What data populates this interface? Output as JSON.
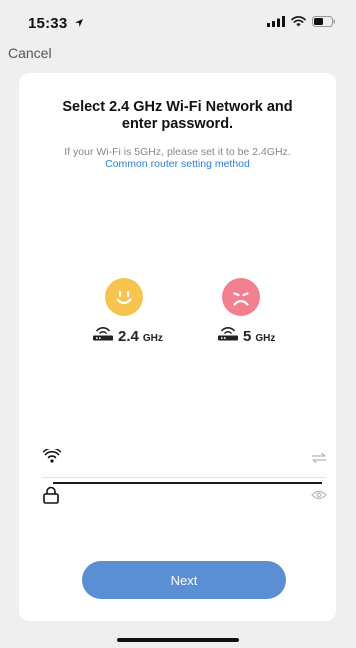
{
  "status_bar": {
    "time": "15:33",
    "icons": [
      "location-arrow-icon",
      "signal-icon",
      "wifi-icon",
      "battery-icon"
    ]
  },
  "nav": {
    "cancel_label": "Cancel"
  },
  "card": {
    "title": "Select 2.4 GHz Wi-Fi Network and enter password.",
    "hint": "If your Wi-Fi is 5GHz, please set it to be 2.4GHz.",
    "link": "Common router setting method",
    "bands": [
      {
        "num": "2.4",
        "unit": "GHz",
        "face": "happy-face-icon",
        "color": "#f7c44f"
      },
      {
        "num": "5",
        "unit": "GHz",
        "face": "sad-face-icon",
        "color": "#f3808e"
      }
    ],
    "ssid_field": {
      "value": "",
      "placeholder": ""
    },
    "password_field": {
      "value": "",
      "placeholder": ""
    },
    "next_label": "Next"
  },
  "colors": {
    "accent": "#5a8fd5",
    "link": "#2d7fd6",
    "background": "#efeff0"
  }
}
